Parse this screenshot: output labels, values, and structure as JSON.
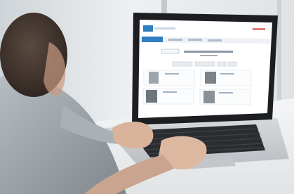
{
  "scene": {
    "subject": "person-typing-on-laptop",
    "colors": {
      "wall": "#e4e8eb",
      "desk": "#f3f4f5",
      "laptop_body": "#c9ccd0",
      "bezel": "#1b1d20",
      "keyboard": "#26282b",
      "screen": "#ffffff",
      "site_accent": "#2f7fc1",
      "skin": "#d8b59f",
      "shirt": "#9aa2a8",
      "hair": "#3a2f2a"
    }
  }
}
